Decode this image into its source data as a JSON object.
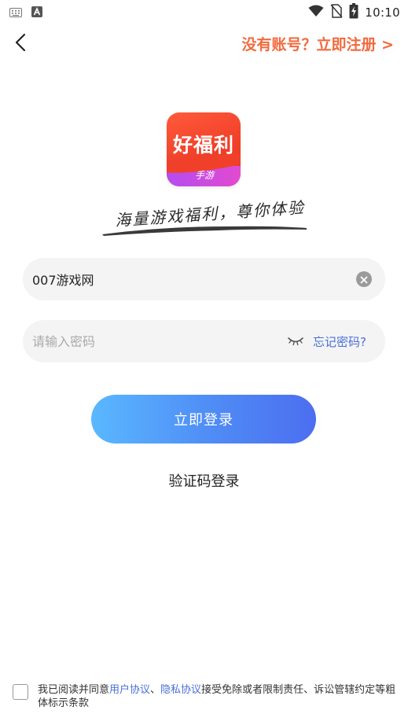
{
  "status_bar": {
    "time": "10:10",
    "left_icons": [
      "keyboard-icon",
      "translate-a-icon"
    ],
    "right_icons": [
      "wifi-icon",
      "sim-off-icon",
      "battery-charging-icon"
    ]
  },
  "header": {
    "back_icon": "chevron-left-icon",
    "register_link": "没有账号？立即注册 >"
  },
  "logo": {
    "title": "好福利",
    "subtitle": "手游"
  },
  "slogan": "海量游戏福利，尊你体验",
  "account_field": {
    "value": "007游戏网",
    "clear_icon": "clear-circle-icon"
  },
  "password_field": {
    "placeholder": "请输入密码",
    "visibility_icon": "eye-closed-icon",
    "forgot_link": "忘记密码?"
  },
  "login_button": "立即登录",
  "sms_login": "验证码登录",
  "agreement": {
    "prefix": "我已阅读并同意",
    "user_agreement": "用户协议",
    "separator": "、",
    "privacy_agreement": "隐私协议",
    "suffix": "接受免除或者限制责任、诉讼管辖约定等粗体标示条款"
  },
  "colors": {
    "accent_orange": "#f26a3d",
    "link_blue": "#4a6fd8",
    "button_gradient_start": "#5ab8ff",
    "button_gradient_end": "#4c6ef0"
  }
}
